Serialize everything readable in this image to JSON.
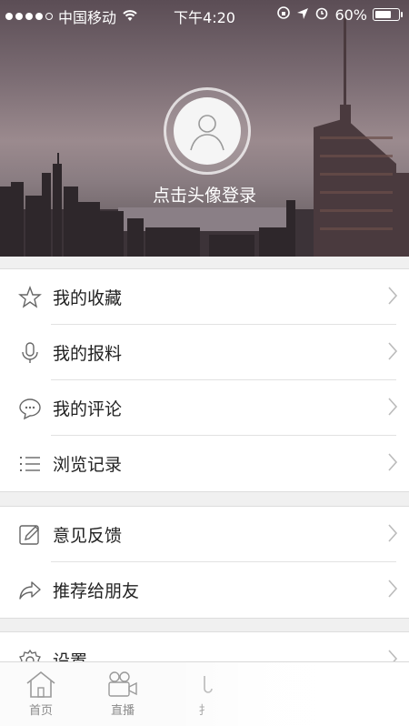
{
  "status_bar": {
    "carrier": "中国移动",
    "time": "下午4:20",
    "battery": "60%"
  },
  "profile": {
    "login_prompt": "点击头像登录"
  },
  "menu_group_1": [
    {
      "label": "我的收藏",
      "icon": "star-icon"
    },
    {
      "label": "我的报料",
      "icon": "microphone-icon"
    },
    {
      "label": "我的评论",
      "icon": "comment-icon"
    },
    {
      "label": "浏览记录",
      "icon": "list-icon"
    }
  ],
  "menu_group_2": [
    {
      "label": "意见反馈",
      "icon": "edit-icon"
    },
    {
      "label": "推荐给朋友",
      "icon": "share-icon"
    }
  ],
  "menu_group_3": [
    {
      "label": "设置",
      "icon": "gear-icon"
    }
  ],
  "tabbar": {
    "home": "首页",
    "live": "直播",
    "third_partial": "扌"
  }
}
